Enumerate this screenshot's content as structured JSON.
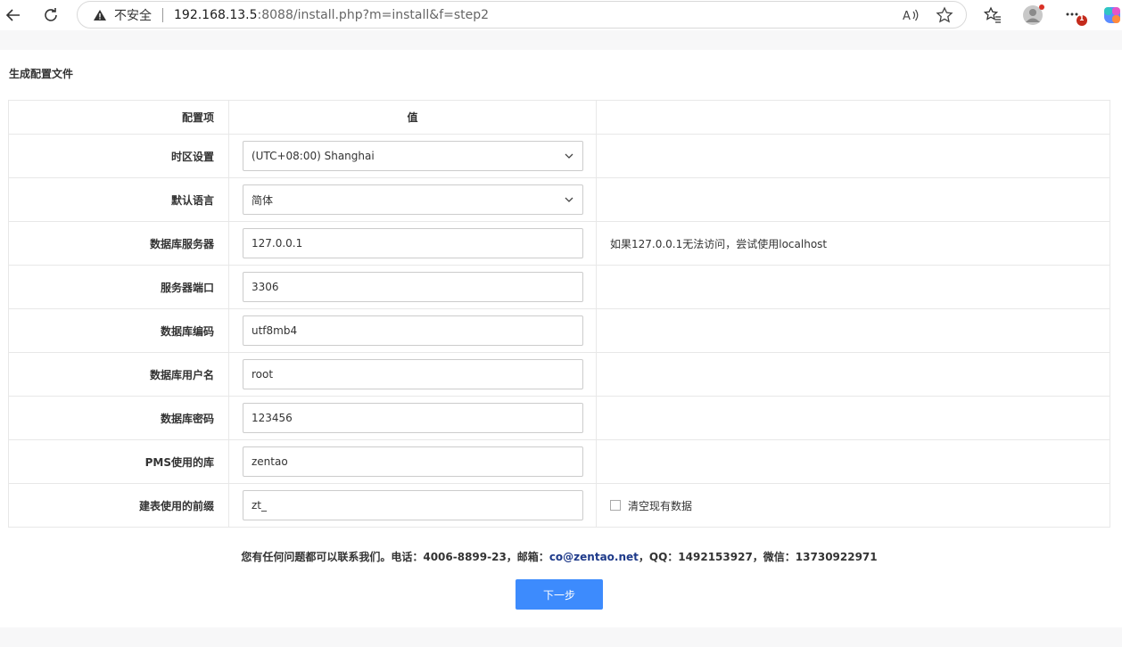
{
  "browser": {
    "insecure_label": "不安全",
    "url_host": "192.168.13.5",
    "url_path": ":8088/install.php?m=install&f=step2",
    "notification_badge": "1"
  },
  "page": {
    "section_title": "生成配置文件",
    "table": {
      "header": {
        "col1": "配置项",
        "col2": "值",
        "col3": ""
      },
      "rows": [
        {
          "label": "时区设置",
          "value": "(UTC+08:00) Shanghai",
          "type": "select",
          "note": ""
        },
        {
          "label": "默认语言",
          "value": "简体",
          "type": "select",
          "note": ""
        },
        {
          "label": "数据库服务器",
          "value": "127.0.0.1",
          "type": "input",
          "note": "如果127.0.0.1无法访问，尝试使用localhost"
        },
        {
          "label": "服务器端口",
          "value": "3306",
          "type": "input",
          "note": ""
        },
        {
          "label": "数据库编码",
          "value": "utf8mb4",
          "type": "input",
          "note": ""
        },
        {
          "label": "数据库用户名",
          "value": "root",
          "type": "input",
          "note": ""
        },
        {
          "label": "数据库密码",
          "value": "123456",
          "type": "input",
          "note": ""
        },
        {
          "label": "PMS使用的库",
          "value": "zentao",
          "type": "input",
          "note": ""
        },
        {
          "label": "建表使用的前缀",
          "value": "zt_",
          "type": "input",
          "checkbox_label": "清空现有数据",
          "checkbox_checked": false
        }
      ]
    },
    "contact": {
      "prefix": "您有任何问题都可以联系我们。电话：4006-8899-23，邮箱：",
      "email": "co@zentao.net",
      "suffix": "，QQ：1492153927，微信：13730922971"
    },
    "next_button": "下一步"
  },
  "colors": {
    "accent": "#3d8bfd",
    "email": "#1e3a8a"
  }
}
